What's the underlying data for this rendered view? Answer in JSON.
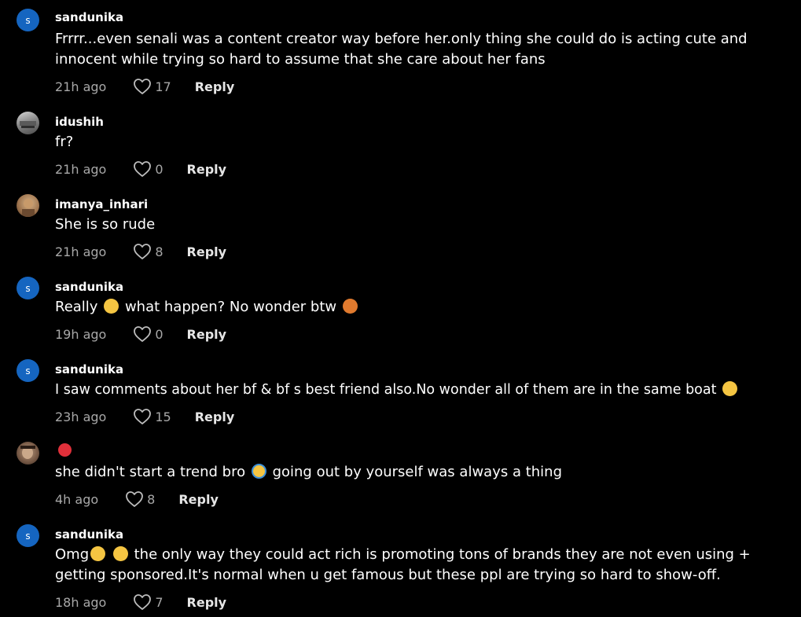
{
  "comments": [
    {
      "username": "sandunika",
      "avatar_letter": "s",
      "avatar_style": "letter",
      "text": "Frrrr...even senali was a content creator way before her.only thing she could do is acting cute and innocent while trying so hard to assume that she care about her fans",
      "time": "21h ago",
      "likes": "17",
      "reply_label": "Reply"
    },
    {
      "username": "idushih",
      "avatar_style": "photo-gray",
      "text": "fr?",
      "time": "21h ago",
      "likes": "0",
      "reply_label": "Reply"
    },
    {
      "username": "imanya_inhari",
      "avatar_style": "photo-tan",
      "text": "She is so rude",
      "time": "21h ago",
      "likes": "8",
      "reply_label": "Reply"
    },
    {
      "username": "sandunika",
      "avatar_letter": "s",
      "avatar_style": "letter",
      "text_a": "Really",
      "text_b": "what happen? No wonder btw",
      "emoji_1": "face-with-rolling-eyes",
      "emoji_2": "person-shrugging",
      "time": "19h ago",
      "likes": "0",
      "reply_label": "Reply"
    },
    {
      "username": "sandunika",
      "avatar_letter": "s",
      "avatar_style": "letter",
      "text": "I saw comments about her bf & bf s best friend also.No wonder all of them are in the same boat",
      "emoji_1": "grinning-squinting-face",
      "time": "23h ago",
      "likes": "15",
      "reply_label": "Reply"
    },
    {
      "username_emoji": "woman-dancing",
      "avatar_style": "photo-brown",
      "text_a": "she didn't start a trend bro",
      "text_b": "going out by yourself was always a thing",
      "emoji_1": "loudly-crying-face",
      "time": "4h ago",
      "likes": "8",
      "reply_label": "Reply"
    },
    {
      "username": "sandunika",
      "avatar_letter": "s",
      "avatar_style": "letter",
      "text_a": "Omg",
      "text_b": "the only way they could act rich is promoting tons of brands they are not even using + getting sponsored.It's normal when u get famous but these ppl are trying so hard to show-off.",
      "emoji_1": "grinning-squinting-face",
      "emoji_2": "face-with-hand-over-mouth",
      "time": "18h ago",
      "likes": "7",
      "reply_label": "Reply"
    }
  ],
  "colors": {
    "background": "#000000",
    "text": "#ffffff",
    "muted": "#a8a8a8",
    "avatar_blue": "#1565c0"
  }
}
